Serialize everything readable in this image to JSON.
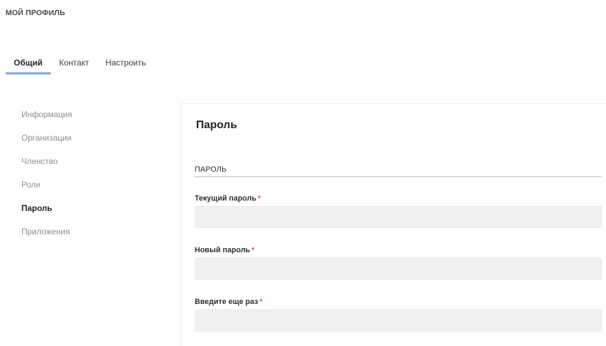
{
  "header": {
    "title": "МОЙ ПРОФИЛЬ"
  },
  "tabs": [
    {
      "label": "Общий",
      "active": true
    },
    {
      "label": "Контакт",
      "active": false
    },
    {
      "label": "Настроить",
      "active": false
    }
  ],
  "sidebar": {
    "items": [
      {
        "label": "Информация",
        "active": false
      },
      {
        "label": "Организации",
        "active": false
      },
      {
        "label": "Членство",
        "active": false
      },
      {
        "label": "Роли",
        "active": false
      },
      {
        "label": "Пароль",
        "active": true
      },
      {
        "label": "Приложения",
        "active": false
      }
    ]
  },
  "panel": {
    "title": "Пароль",
    "section_label": "ПАРОЛЬ",
    "fields": [
      {
        "label": "Текущий пароль",
        "required_mark": "*",
        "value": ""
      },
      {
        "label": "Новый пароль",
        "required_mark": "*",
        "value": ""
      },
      {
        "label": "Введите еще раз",
        "required_mark": "*",
        "value": ""
      }
    ]
  },
  "colors": {
    "accent_underline": "#7aa6e8",
    "required_mark": "#d9534f",
    "input_background": "#f0f1f3",
    "muted_text": "#8a9096"
  }
}
